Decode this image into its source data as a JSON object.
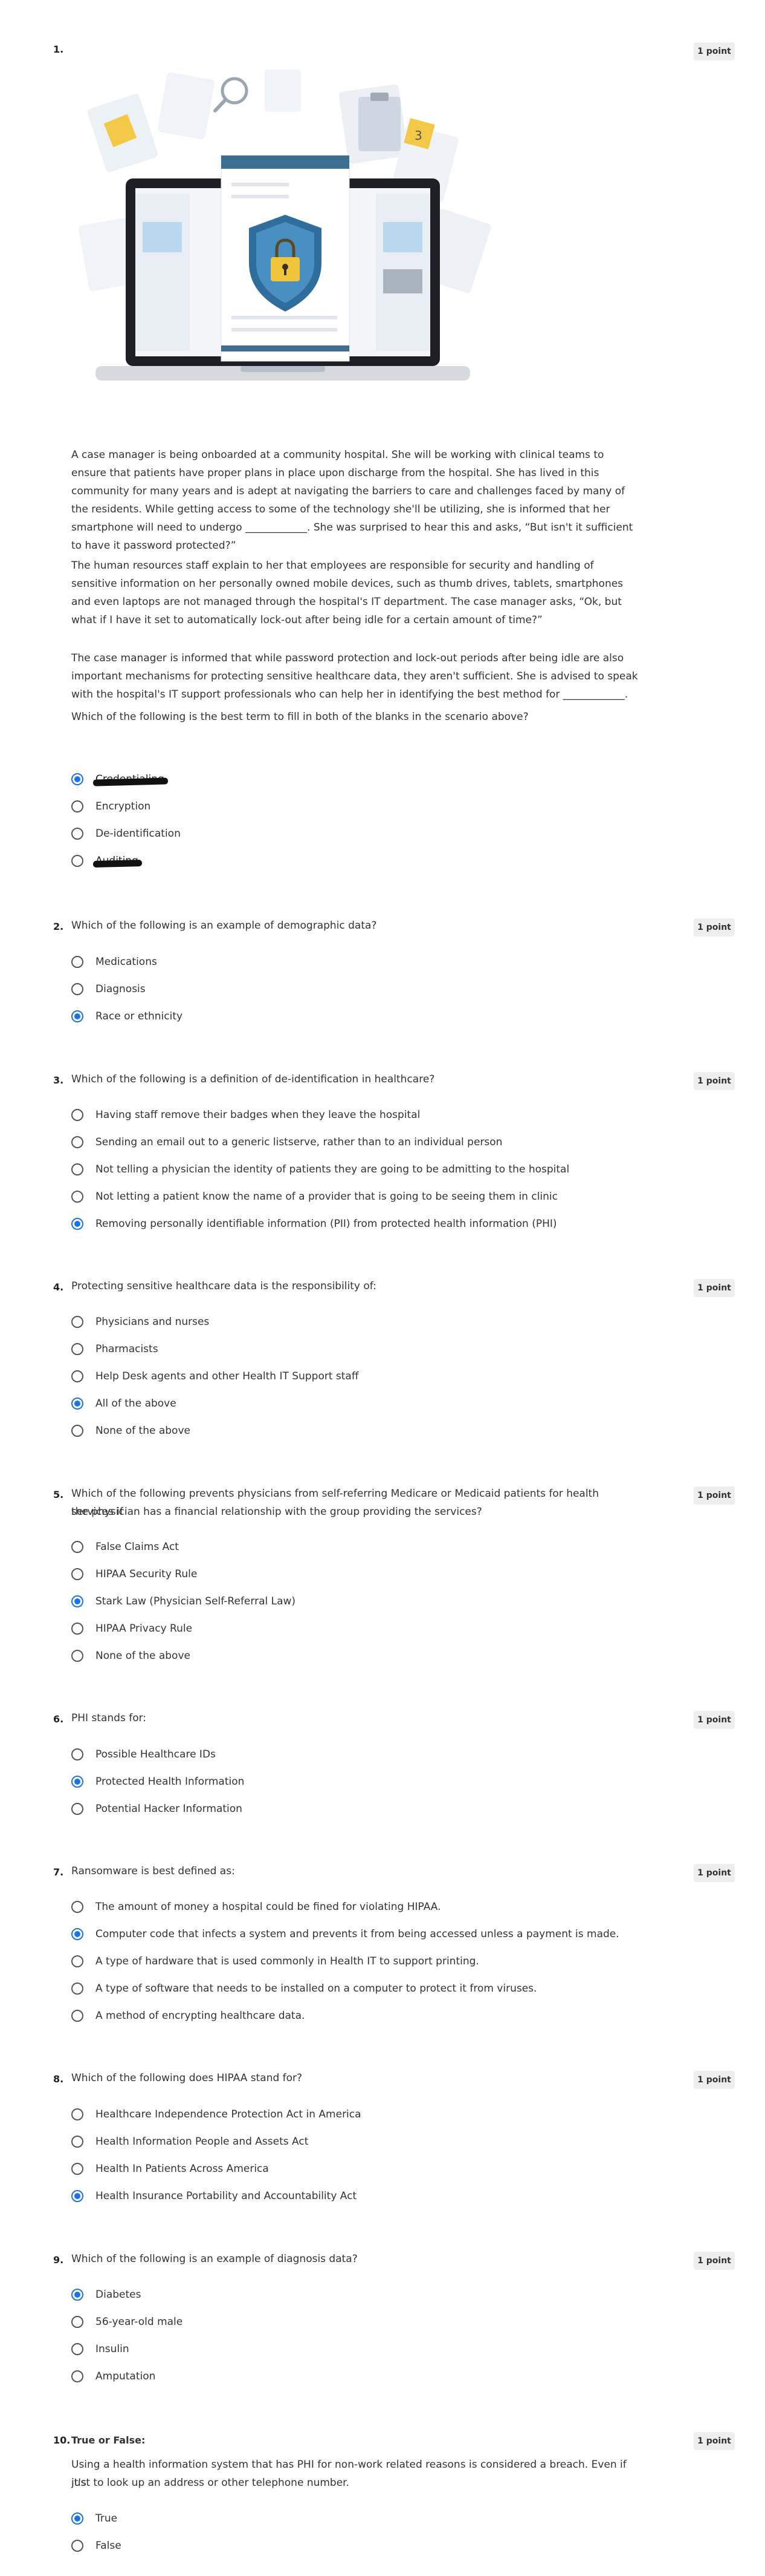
{
  "colors": {
    "accent": "#1a73e8",
    "badge_bg": "#eeeeee",
    "text": "#333333"
  },
  "questions": [
    {
      "number": "1.",
      "points": "1 point",
      "image_icon": "security-shield-laptop-illustration",
      "paragraphs": [
        "A case manager is being onboarded at a community hospital. She will be working with clinical teams to ensure that patients have proper plans in place upon discharge from the hospital. She has lived in this community for many years and is adept at navigating the barriers to care and challenges faced by many of the residents. While getting access to some of the technology she'll be utilizing, she is informed that her smartphone will need to undergo ____________. She was surprised to hear this and asks, “But isn't it sufficient to have it password protected?”",
        "The human resources staff explain to her that employees are responsible for security and handling of sensitive information on her personally owned mobile devices, such as thumb drives, tablets, smartphones and even laptops are not managed through the hospital's IT department. The case manager asks, “Ok, but what if I have it set to automatically lock-out after being idle for a certain amount of time?”",
        "The case manager is informed that while password protection and lock-out periods after being idle are also important mechanisms for protecting sensitive healthcare data, they aren't sufficient. She is advised to speak with the hospital's IT support professionals who can help her in identifying the best method for ____________.",
        "Which of the following is the best term to fill in both of the blanks in the scenario above?"
      ],
      "options": [
        "Credentialing",
        "Encryption",
        "De-identification",
        "Auditing"
      ],
      "selected": 0
    },
    {
      "number": "2.",
      "points": "1 point",
      "prompt": "Which of the following is an example of demographic data?",
      "options": [
        "Medications",
        "Diagnosis",
        "Race or ethnicity"
      ],
      "selected": 2
    },
    {
      "number": "3.",
      "points": "1 point",
      "prompt": "Which of the following is a definition of de-identification in healthcare?",
      "options": [
        "Having staff remove their badges when they leave the hospital",
        "Sending an email out to a generic listserve, rather than to an individual person",
        "Not telling a physician the identity of patients they are going to be admitting to the hospital",
        "Not letting a patient know the name of a provider that is going to be seeing them in clinic",
        "Removing personally identifiable information (PII) from protected health information (PHI)"
      ],
      "selected": 4
    },
    {
      "number": "4.",
      "points": "1 point",
      "prompt": "Protecting sensitive healthcare data is the responsibility of:",
      "options": [
        "Physicians and nurses",
        "Pharmacists",
        "Help Desk agents and other Health IT Support staff",
        "All of the above",
        "None of the above"
      ],
      "selected": 3
    },
    {
      "number": "5.",
      "points": "1 point",
      "prompt_lines": [
        "Which of the following prevents physicians from self-referring Medicare or Medicaid patients for health services if",
        "the physician has a financial relationship with the group providing the services?"
      ],
      "options": [
        "False Claims Act",
        "HIPAA Security Rule",
        "Stark Law (Physician Self-Referral Law)",
        "HIPAA Privacy Rule",
        "None of the above"
      ],
      "selected": 2
    },
    {
      "number": "6.",
      "points": "1 point",
      "prompt": "PHI stands for:",
      "options": [
        "Possible Healthcare IDs",
        "Protected Health Information",
        "Potential Hacker Information"
      ],
      "selected": 1
    },
    {
      "number": "7.",
      "points": "1 point",
      "prompt": "Ransomware is best defined as:",
      "options": [
        "The amount of money a hospital could be fined for violating HIPAA.",
        "Computer code that infects a system and prevents it from being accessed unless a payment is made.",
        "A type of hardware that is used commonly in Health IT to support printing.",
        "A type of software that needs to be installed on a computer to protect it from viruses.",
        "A method of encrypting healthcare data."
      ],
      "selected": 1
    },
    {
      "number": "8.",
      "points": "1 point",
      "prompt": "Which of the following does HIPAA stand for?",
      "options": [
        "Healthcare Independence Protection Act in America",
        "Health Information People and Assets Act",
        "Health In Patients Across America",
        "Health Insurance Portability and Accountability Act"
      ],
      "selected": 3
    },
    {
      "number": "9.",
      "points": "1 point",
      "prompt": "Which of the following is an example of diagnosis data?",
      "options": [
        "Diabetes",
        "56-year-old male",
        "Insulin",
        "Amputation"
      ],
      "selected": 0
    },
    {
      "number": "10.",
      "points": "1 point",
      "label": "True or False:",
      "prompt_lines": [
        "Using a health information system that has PHI for non-work related reasons is considered a breach. Even if it's",
        "just to look up an address or other telephone number."
      ],
      "options": [
        "True",
        "False"
      ],
      "selected": 0
    }
  ]
}
